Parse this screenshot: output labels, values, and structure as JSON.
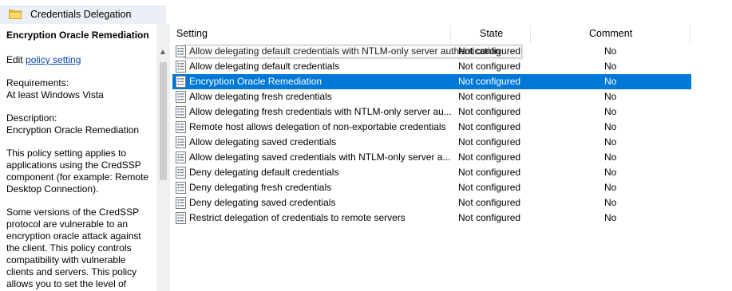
{
  "window": {
    "title": "Credentials Delegation"
  },
  "description": {
    "heading": "Encryption Oracle Remediation",
    "edit_prefix": "Edit ",
    "edit_link": "policy setting ",
    "requirements_label": "Requirements:",
    "requirements_value": "At least Windows Vista",
    "description_label": "Description:",
    "description_value": "Encryption Oracle Remediation",
    "para1": "This policy setting applies to applications using the CredSSP component (for example: Remote Desktop Connection).",
    "para2": "Some versions of the CredSSP protocol are vulnerable to an encryption oracle attack against the client.  This policy controls compatibility with vulnerable clients and servers.  This policy allows you to set the level of"
  },
  "table": {
    "columns": {
      "setting": "Setting",
      "state": "State",
      "comment": "Comment"
    },
    "rows": [
      {
        "setting": "Allow delegating default credentials with NTLM-only server authentication",
        "state": "Not configured",
        "comment": "No"
      },
      {
        "setting": "Allow delegating default credentials",
        "state": "Not configured",
        "comment": "No"
      },
      {
        "setting": "Encryption Oracle Remediation",
        "state": "Not configured",
        "comment": "No"
      },
      {
        "setting": "Allow delegating fresh credentials",
        "state": "Not configured",
        "comment": "No"
      },
      {
        "setting": "Allow delegating fresh credentials with NTLM-only server au...",
        "state": "Not configured",
        "comment": "No"
      },
      {
        "setting": "Remote host allows delegation of non-exportable credentials",
        "state": "Not configured",
        "comment": "No"
      },
      {
        "setting": "Allow delegating saved credentials",
        "state": "Not configured",
        "comment": "No"
      },
      {
        "setting": "Allow delegating saved credentials with NTLM-only server a...",
        "state": "Not configured",
        "comment": "No"
      },
      {
        "setting": "Deny delegating default credentials",
        "state": "Not configured",
        "comment": "No"
      },
      {
        "setting": "Deny delegating fresh credentials",
        "state": "Not configured",
        "comment": "No"
      },
      {
        "setting": "Deny delegating saved credentials",
        "state": "Not configured",
        "comment": "No"
      },
      {
        "setting": "Restrict delegation of credentials to remote servers",
        "state": "Not configured",
        "comment": "No"
      }
    ],
    "selected_index": 2
  },
  "colors": {
    "selection": "#0078d7",
    "header_band": "#ebf0f7",
    "link": "#0645ad"
  },
  "icons": {
    "folder": "folder-icon",
    "setting": "policy-setting-icon",
    "scroll_up": "scroll-up-arrow-icon"
  }
}
